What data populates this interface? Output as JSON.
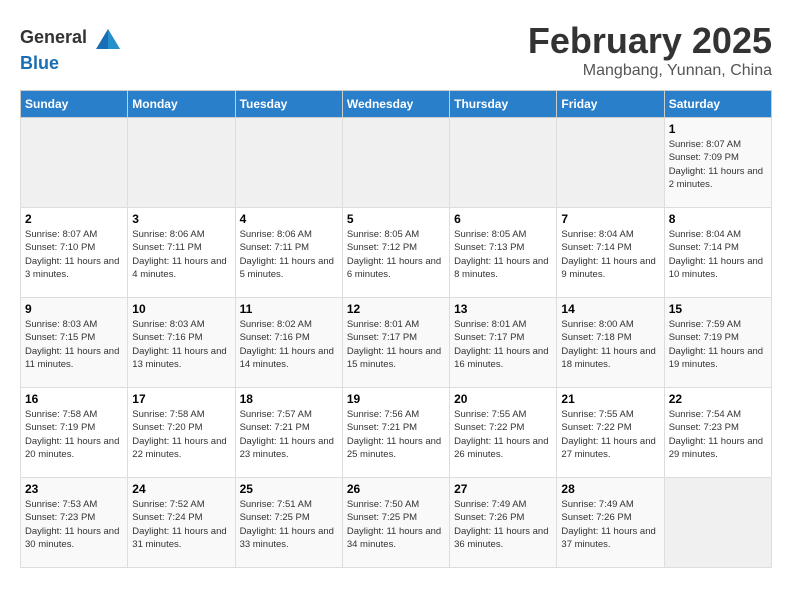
{
  "header": {
    "logo_general": "General",
    "logo_blue": "Blue",
    "title": "February 2025",
    "subtitle": "Mangbang, Yunnan, China"
  },
  "calendar": {
    "days_of_week": [
      "Sunday",
      "Monday",
      "Tuesday",
      "Wednesday",
      "Thursday",
      "Friday",
      "Saturday"
    ],
    "weeks": [
      [
        {
          "day": "",
          "sunrise": "",
          "sunset": "",
          "daylight": ""
        },
        {
          "day": "",
          "sunrise": "",
          "sunset": "",
          "daylight": ""
        },
        {
          "day": "",
          "sunrise": "",
          "sunset": "",
          "daylight": ""
        },
        {
          "day": "",
          "sunrise": "",
          "sunset": "",
          "daylight": ""
        },
        {
          "day": "",
          "sunrise": "",
          "sunset": "",
          "daylight": ""
        },
        {
          "day": "",
          "sunrise": "",
          "sunset": "",
          "daylight": ""
        },
        {
          "day": "1",
          "sunrise": "Sunrise: 8:07 AM",
          "sunset": "Sunset: 7:09 PM",
          "daylight": "Daylight: 11 hours and 2 minutes."
        }
      ],
      [
        {
          "day": "2",
          "sunrise": "Sunrise: 8:07 AM",
          "sunset": "Sunset: 7:10 PM",
          "daylight": "Daylight: 11 hours and 3 minutes."
        },
        {
          "day": "3",
          "sunrise": "Sunrise: 8:06 AM",
          "sunset": "Sunset: 7:11 PM",
          "daylight": "Daylight: 11 hours and 4 minutes."
        },
        {
          "day": "4",
          "sunrise": "Sunrise: 8:06 AM",
          "sunset": "Sunset: 7:11 PM",
          "daylight": "Daylight: 11 hours and 5 minutes."
        },
        {
          "day": "5",
          "sunrise": "Sunrise: 8:05 AM",
          "sunset": "Sunset: 7:12 PM",
          "daylight": "Daylight: 11 hours and 6 minutes."
        },
        {
          "day": "6",
          "sunrise": "Sunrise: 8:05 AM",
          "sunset": "Sunset: 7:13 PM",
          "daylight": "Daylight: 11 hours and 8 minutes."
        },
        {
          "day": "7",
          "sunrise": "Sunrise: 8:04 AM",
          "sunset": "Sunset: 7:14 PM",
          "daylight": "Daylight: 11 hours and 9 minutes."
        },
        {
          "day": "8",
          "sunrise": "Sunrise: 8:04 AM",
          "sunset": "Sunset: 7:14 PM",
          "daylight": "Daylight: 11 hours and 10 minutes."
        }
      ],
      [
        {
          "day": "9",
          "sunrise": "Sunrise: 8:03 AM",
          "sunset": "Sunset: 7:15 PM",
          "daylight": "Daylight: 11 hours and 11 minutes."
        },
        {
          "day": "10",
          "sunrise": "Sunrise: 8:03 AM",
          "sunset": "Sunset: 7:16 PM",
          "daylight": "Daylight: 11 hours and 13 minutes."
        },
        {
          "day": "11",
          "sunrise": "Sunrise: 8:02 AM",
          "sunset": "Sunset: 7:16 PM",
          "daylight": "Daylight: 11 hours and 14 minutes."
        },
        {
          "day": "12",
          "sunrise": "Sunrise: 8:01 AM",
          "sunset": "Sunset: 7:17 PM",
          "daylight": "Daylight: 11 hours and 15 minutes."
        },
        {
          "day": "13",
          "sunrise": "Sunrise: 8:01 AM",
          "sunset": "Sunset: 7:17 PM",
          "daylight": "Daylight: 11 hours and 16 minutes."
        },
        {
          "day": "14",
          "sunrise": "Sunrise: 8:00 AM",
          "sunset": "Sunset: 7:18 PM",
          "daylight": "Daylight: 11 hours and 18 minutes."
        },
        {
          "day": "15",
          "sunrise": "Sunrise: 7:59 AM",
          "sunset": "Sunset: 7:19 PM",
          "daylight": "Daylight: 11 hours and 19 minutes."
        }
      ],
      [
        {
          "day": "16",
          "sunrise": "Sunrise: 7:58 AM",
          "sunset": "Sunset: 7:19 PM",
          "daylight": "Daylight: 11 hours and 20 minutes."
        },
        {
          "day": "17",
          "sunrise": "Sunrise: 7:58 AM",
          "sunset": "Sunset: 7:20 PM",
          "daylight": "Daylight: 11 hours and 22 minutes."
        },
        {
          "day": "18",
          "sunrise": "Sunrise: 7:57 AM",
          "sunset": "Sunset: 7:21 PM",
          "daylight": "Daylight: 11 hours and 23 minutes."
        },
        {
          "day": "19",
          "sunrise": "Sunrise: 7:56 AM",
          "sunset": "Sunset: 7:21 PM",
          "daylight": "Daylight: 11 hours and 25 minutes."
        },
        {
          "day": "20",
          "sunrise": "Sunrise: 7:55 AM",
          "sunset": "Sunset: 7:22 PM",
          "daylight": "Daylight: 11 hours and 26 minutes."
        },
        {
          "day": "21",
          "sunrise": "Sunrise: 7:55 AM",
          "sunset": "Sunset: 7:22 PM",
          "daylight": "Daylight: 11 hours and 27 minutes."
        },
        {
          "day": "22",
          "sunrise": "Sunrise: 7:54 AM",
          "sunset": "Sunset: 7:23 PM",
          "daylight": "Daylight: 11 hours and 29 minutes."
        }
      ],
      [
        {
          "day": "23",
          "sunrise": "Sunrise: 7:53 AM",
          "sunset": "Sunset: 7:23 PM",
          "daylight": "Daylight: 11 hours and 30 minutes."
        },
        {
          "day": "24",
          "sunrise": "Sunrise: 7:52 AM",
          "sunset": "Sunset: 7:24 PM",
          "daylight": "Daylight: 11 hours and 31 minutes."
        },
        {
          "day": "25",
          "sunrise": "Sunrise: 7:51 AM",
          "sunset": "Sunset: 7:25 PM",
          "daylight": "Daylight: 11 hours and 33 minutes."
        },
        {
          "day": "26",
          "sunrise": "Sunrise: 7:50 AM",
          "sunset": "Sunset: 7:25 PM",
          "daylight": "Daylight: 11 hours and 34 minutes."
        },
        {
          "day": "27",
          "sunrise": "Sunrise: 7:49 AM",
          "sunset": "Sunset: 7:26 PM",
          "daylight": "Daylight: 11 hours and 36 minutes."
        },
        {
          "day": "28",
          "sunrise": "Sunrise: 7:49 AM",
          "sunset": "Sunset: 7:26 PM",
          "daylight": "Daylight: 11 hours and 37 minutes."
        },
        {
          "day": "",
          "sunrise": "",
          "sunset": "",
          "daylight": ""
        }
      ]
    ]
  }
}
